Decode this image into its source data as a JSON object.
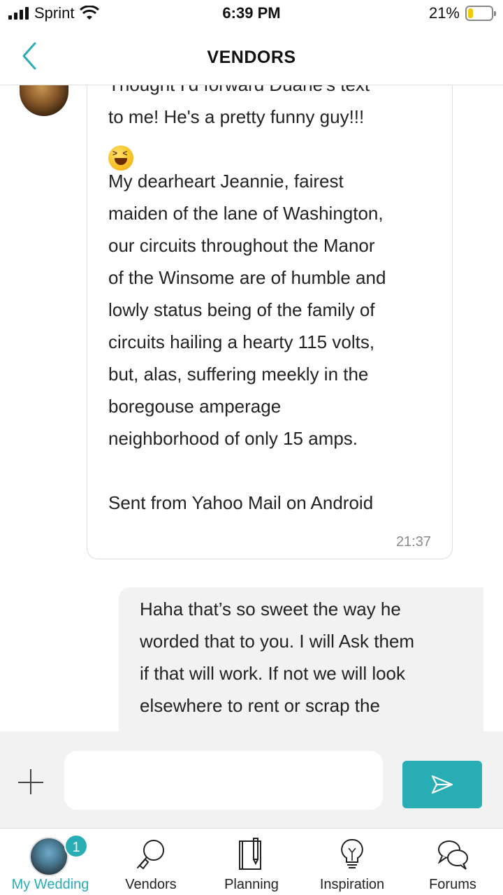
{
  "status_bar": {
    "carrier": "Sprint",
    "time": "6:39 PM",
    "battery_percent": "21%",
    "battery_level": 0.21
  },
  "nav": {
    "title": "VENDORS",
    "back_icon": "chevron-left-icon",
    "accent_color": "#29adb5"
  },
  "messages": {
    "incoming": {
      "lines_top": [
        "Thought I'd forward Duane's text",
        "to me!  He's a pretty funny guy!!!"
      ],
      "emoji": "laughing-squint-emoji",
      "body_lines": [
        "My dearheart Jeannie, fairest",
        "maiden of the lane of Washington,",
        "our circuits throughout the Manor",
        "of the Winsome are of humble and",
        "lowly status being of the family of",
        "circuits hailing a hearty 115 volts,",
        "but, alas, suffering meekly in the",
        "boregouse amperage",
        "neighborhood of only 15 amps."
      ],
      "signature": "Sent from Yahoo Mail on Android",
      "time": "21:37"
    },
    "outgoing": {
      "lines": [
        "Haha that’s so sweet the way he",
        "worded that to you. I will Ask them",
        "if that will work. If not we will look",
        "elsewhere to rent or scrap the"
      ]
    }
  },
  "composer": {
    "placeholder": "",
    "add_icon": "plus-icon",
    "send_icon": "send-icon"
  },
  "tabs": [
    {
      "label": "My Wedding",
      "icon": "wedding-avatar",
      "badge": "1",
      "active": true
    },
    {
      "label": "Vendors",
      "icon": "magnifier-icon",
      "active": false
    },
    {
      "label": "Planning",
      "icon": "notebook-icon",
      "active": false
    },
    {
      "label": "Inspiration",
      "icon": "lightbulb-icon",
      "active": false
    },
    {
      "label": "Forums",
      "icon": "chat-bubbles-icon",
      "active": false
    }
  ]
}
